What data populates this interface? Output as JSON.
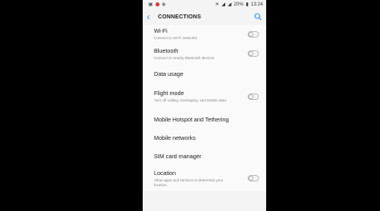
{
  "status_bar": {
    "battery": "20%",
    "time": "13:24"
  },
  "header": {
    "title": "CONNECTIONS",
    "back_icon": "back-arrow-icon",
    "search_icon": "search-icon"
  },
  "items": [
    {
      "label": "Wi-Fi",
      "sub": "Connect to Wi-Fi networks",
      "toggle": true,
      "on": false
    },
    {
      "label": "Bluetooth",
      "sub": "Connect to nearby Bluetooth devices",
      "toggle": true,
      "on": false
    },
    {
      "label": "Data usage",
      "sub": "",
      "toggle": false
    },
    {
      "label": "Flight mode",
      "sub": "Turn off calling, messaging, and Mobile data.",
      "toggle": true,
      "on": false
    },
    {
      "label": "Mobile Hotspot and Tethering",
      "sub": "",
      "toggle": false
    },
    {
      "label": "Mobile networks",
      "sub": "",
      "toggle": false
    },
    {
      "label": "SIM card manager",
      "sub": "",
      "toggle": false
    },
    {
      "label": "Location",
      "sub": "Allow apps and services to determine your location.",
      "toggle": true,
      "on": false
    }
  ],
  "colors": {
    "accent": "#3b8fd6",
    "background": "#000000"
  }
}
